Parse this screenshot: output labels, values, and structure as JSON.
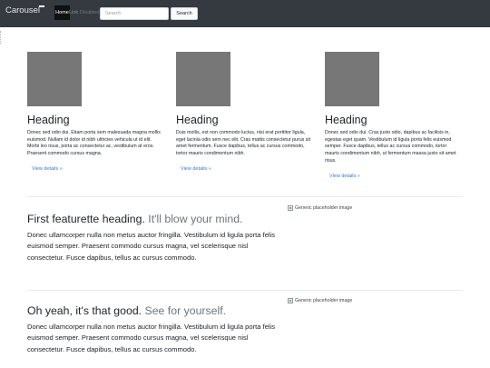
{
  "navbar": {
    "brand": "Carousel",
    "links": [
      "Home",
      "Link",
      "Disabled"
    ],
    "search": {
      "placeholder": "Search",
      "button_label": "Search"
    }
  },
  "columns": [
    {
      "heading": "Heading",
      "text": "Donec sed odio dui. Etiam porta sem malesuada magna mollis euismod. Nullam id dolor id nibh ultricies vehicula ut id elit. Morbi leo risus, porta ac consectetur ac, vestibulum at eros. Praesent commodo cursus magna.",
      "button": "View details »"
    },
    {
      "heading": "Heading",
      "text": "Duis mollis, est non commodo luctus, nisi erat porttitor ligula, eget lacinia odio sem nec elit. Cras mattis consectetur purus sit amet fermentum. Fusce dapibus, tellus ac cursus commodo, tortor mauris condimentum nibh.",
      "button": "View details »"
    },
    {
      "heading": "Heading",
      "text": "Donec sed odio dui. Cras justo odio, dapibus ac facilisis in, egestas eget quam. Vestibulum id ligula porta felis euismod semper. Fusce dapibus, tellus ac cursus commodo, tortor mauris condimentum nibh, ut fermentum massa justo sit amet risus.",
      "button": "View details »"
    }
  ],
  "featurettes": [
    {
      "heading": "First featurette heading.",
      "muted": "It'll blow your mind.",
      "text": "Donec ullamcorper nulla non metus auctor fringilla. Vestibulum id ligula porta felis euismod semper. Praesent commodo cursus magna, vel scelerisque nisl consectetur. Fusce dapibus, tellus ac cursus commodo.",
      "image_alt": "Generic placeholder image"
    },
    {
      "heading": "Oh yeah, it's that good.",
      "muted": "See for yourself.",
      "text": "Donec ullamcorper nulla non metus auctor fringilla. Vestibulum id ligula porta felis euismod semper. Praesent commodo cursus magna, vel scelerisque nisl consectetur. Fusce dapibus, tellus ac cursus commodo.",
      "image_alt": "Generic placeholder image"
    }
  ],
  "colors": {
    "navbar_bg": "#343a40",
    "link": "#2a7fd4",
    "thumb": "#777777",
    "muted": "#6c757d"
  }
}
